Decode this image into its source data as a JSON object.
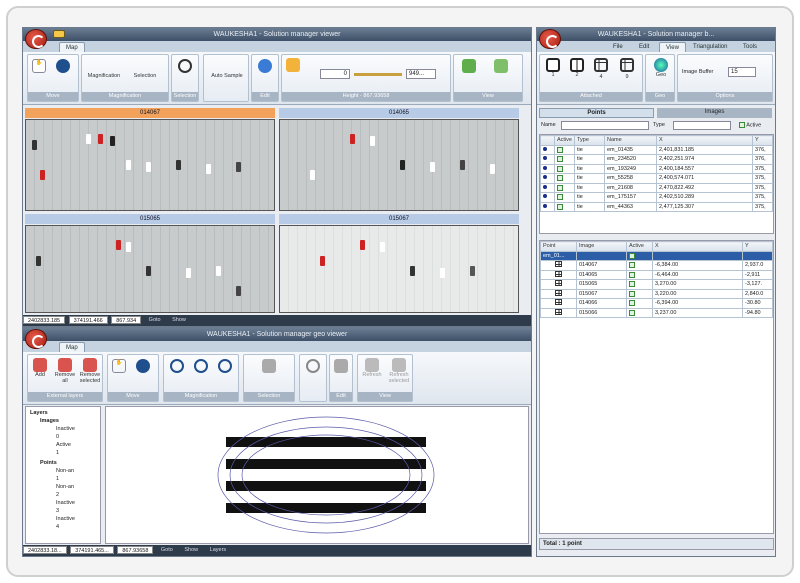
{
  "solution_viewer": {
    "title": "WAUKESHA1 - Solution manager viewer",
    "tab": "Map",
    "groups": [
      "Move",
      "Magnification",
      "Selection",
      "Edit",
      "Height - 867.93658",
      "View"
    ],
    "buttons": [
      "Magnification",
      "Selection",
      "Auto Sample"
    ],
    "height_value": "0",
    "height_max": "949...",
    "images": [
      "014067",
      "014065",
      "015065",
      "015067"
    ],
    "status": {
      "x": "2402833.185",
      "y": "374191.466",
      "z": "867.934",
      "goto": "Goto",
      "show": "Show"
    }
  },
  "geo_viewer": {
    "title": "WAUKESHA1 - Solution manager geo viewer",
    "tab": "Map",
    "buttons": [
      "Add",
      "Remove all",
      "Remove selected",
      "Refresh",
      "Refresh selected"
    ],
    "groups": [
      "External layers",
      "Move",
      "Magnification",
      "Selection",
      "Edit",
      "View"
    ],
    "tree": [
      "Layers",
      "Images",
      "Inactive",
      "0",
      "Active",
      "1",
      "Points",
      "Non-an",
      "1",
      "Non-an",
      "2",
      "Inactive",
      "3",
      "Inactive",
      "4"
    ],
    "status": {
      "x": "2402833.18...",
      "y": "374191.465...",
      "z": "867.93658",
      "goto": "Goto",
      "show": "Show",
      "layers": "Layers"
    }
  },
  "panel": {
    "title": "WAUKESHA1 - Solution manager b...",
    "tabs": [
      "File",
      "Edit",
      "View",
      "Triangulation",
      "Tools"
    ],
    "layouts": [
      "1",
      "2",
      "4",
      "9"
    ],
    "geo": "Geo",
    "image_buffer_label": "Image Buffer",
    "image_buffer_value": "15",
    "groups": [
      "Attached",
      "Geo",
      "Options"
    ],
    "subtabs": [
      "Points",
      "Images"
    ],
    "filter": {
      "name_label": "Name",
      "type_label": "Type",
      "active_label": "Active"
    },
    "points_headers": [
      "",
      "Active",
      "Type",
      "Name",
      "X",
      "Y"
    ],
    "points": [
      [
        "tie",
        "em_01435",
        "2,401,831.185",
        "376,"
      ],
      [
        "tie",
        "em_234520",
        "2,402,251.974",
        "376,"
      ],
      [
        "tie",
        "em_193249",
        "2,400,184.557",
        "375,"
      ],
      [
        "tie",
        "em_55258",
        "2,400,574.071",
        "375,"
      ],
      [
        "tie",
        "em_21608",
        "2,470,822.492",
        "375,"
      ],
      [
        "tie",
        "em_175157",
        "2,402,510.289",
        "375,"
      ],
      [
        "tie",
        "em_44363",
        "2,477,125.307",
        "375,"
      ]
    ],
    "img_headers": [
      "Point",
      "Image",
      "Active",
      "X",
      "Y"
    ],
    "img_sel": "em_01...",
    "img_rows": [
      [
        "014067",
        "-6,384.00",
        "2,937.0"
      ],
      [
        "014065",
        "-6,464.00",
        "-2,911"
      ],
      [
        "015065",
        "3,270.00",
        "-3,127."
      ],
      [
        "015067",
        "3,220.00",
        "2,840.0"
      ],
      [
        "014066",
        "-6,394.00",
        "-30.80"
      ],
      [
        "015066",
        "3,237.00",
        "-94.80"
      ]
    ],
    "total": "Total : 1 point"
  }
}
